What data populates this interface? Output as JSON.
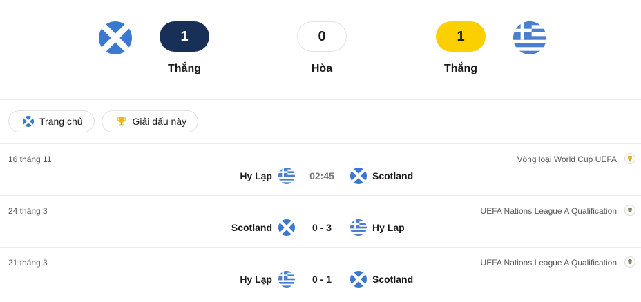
{
  "summary": {
    "home_team_flag": "scotland-flag",
    "away_team_flag": "greece-flag",
    "home_wins": "1",
    "draws": "0",
    "away_wins": "1",
    "home_label": "Thắng",
    "draw_label": "Hòa",
    "away_label": "Thắng",
    "colors": {
      "home_pill": "#183058",
      "away_pill": "#fccf00"
    }
  },
  "tabs": [
    {
      "label": "Trang chủ",
      "icon": "scotland-flag-icon"
    },
    {
      "label": "Giải dấu này",
      "icon": "trophy-icon"
    }
  ],
  "matches": [
    {
      "date": "16 tháng 11",
      "competition": "Vòng loại World Cup UEFA",
      "competition_icon": "world-cup-icon",
      "home": "Hy Lạp",
      "home_flag": "greece",
      "score": "02:45",
      "away": "Scotland",
      "away_flag": "scotland"
    },
    {
      "date": "24 tháng 3",
      "competition": "UEFA Nations League A Qualification",
      "competition_icon": "nations-league-icon",
      "home": "Scotland",
      "home_flag": "scotland",
      "score": "0 - 3",
      "away": "Hy Lạp",
      "away_flag": "greece"
    },
    {
      "date": "21 tháng 3",
      "competition": "UEFA Nations League A Qualification",
      "competition_icon": "nations-league-icon",
      "home": "Hy Lạp",
      "home_flag": "greece",
      "score": "0 - 1",
      "away": "Scotland",
      "away_flag": "scotland"
    }
  ]
}
